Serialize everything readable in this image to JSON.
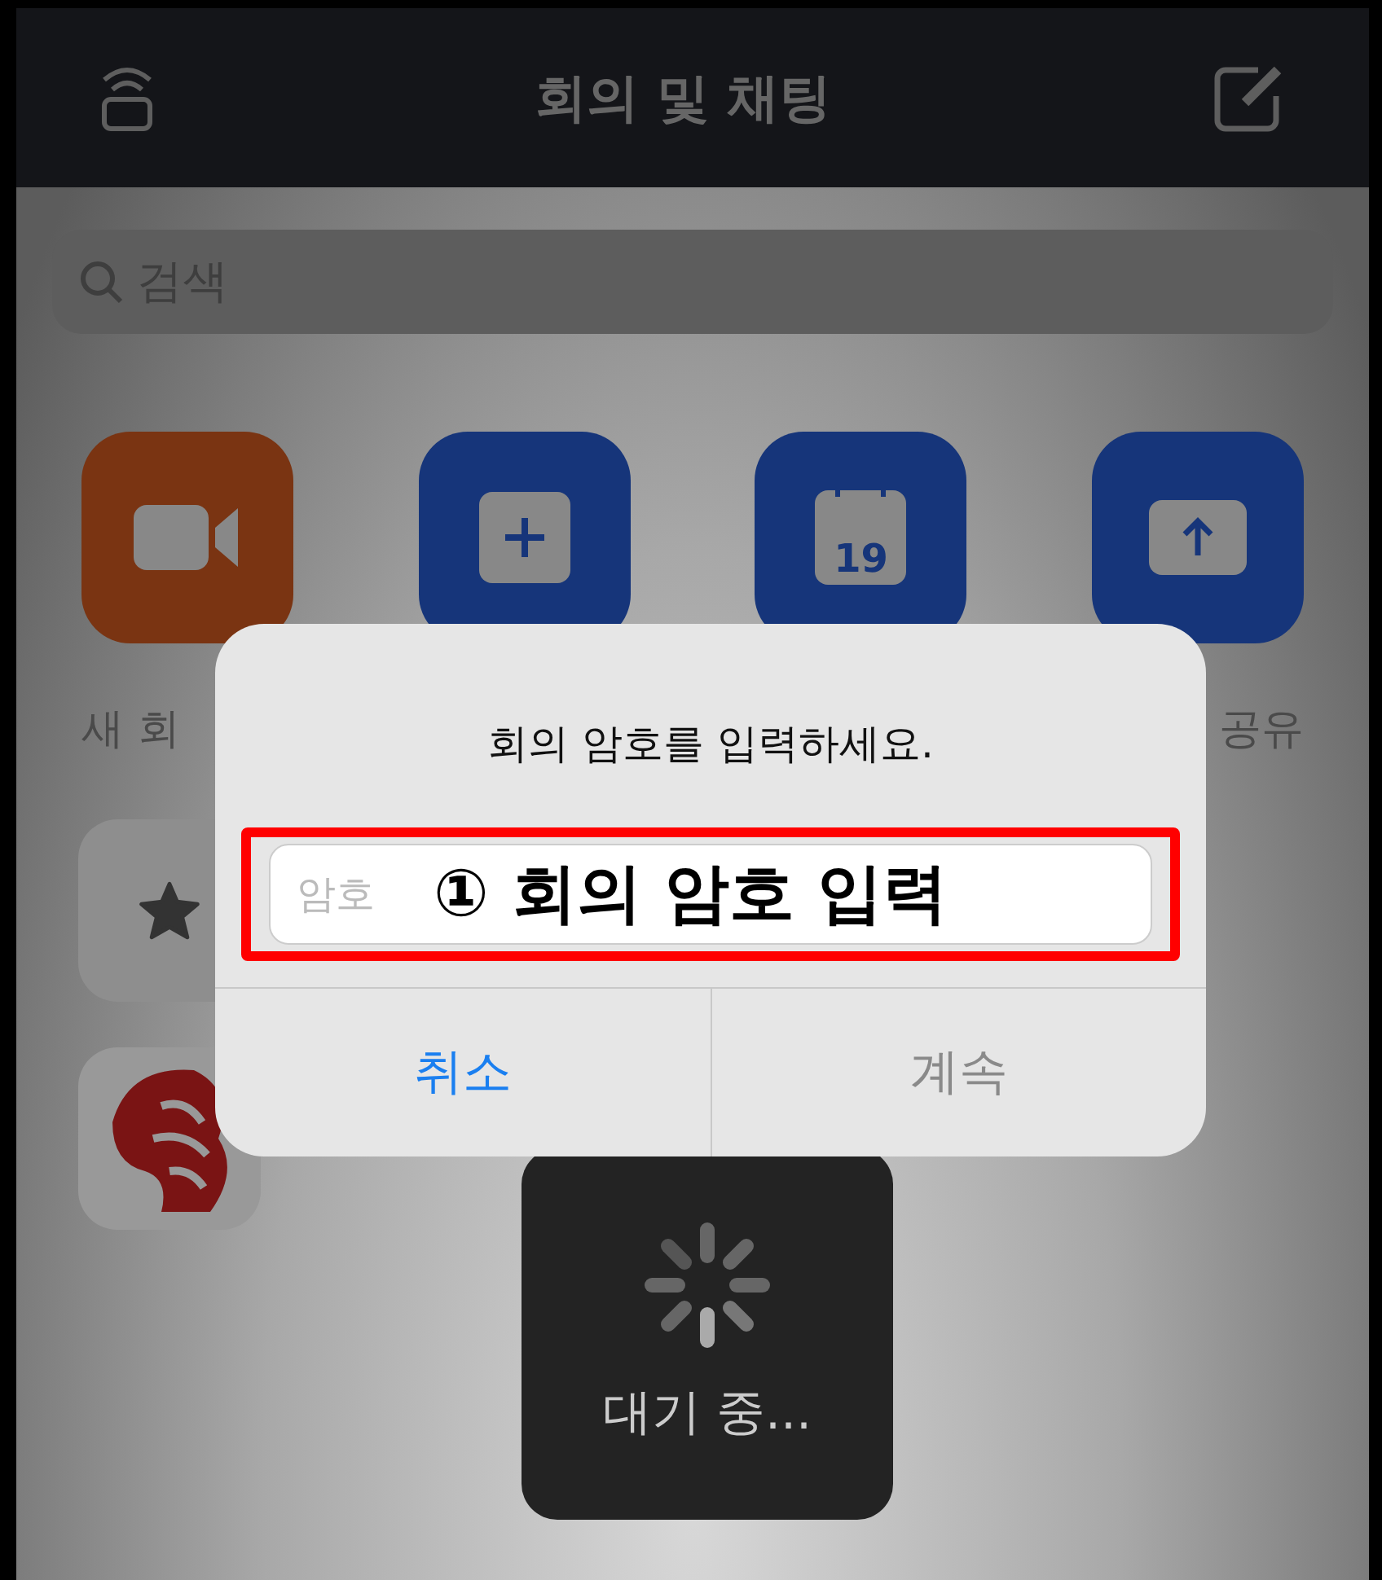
{
  "header": {
    "title": "회의 및 채팅"
  },
  "search": {
    "placeholder": "검색"
  },
  "tiles": [
    {
      "kind": "video",
      "color": "#7a3412",
      "label": "새 회"
    },
    {
      "kind": "plus",
      "color": "#16357a"
    },
    {
      "kind": "calendar",
      "color": "#16357a",
      "day": "19"
    },
    {
      "kind": "upload",
      "color": "#16357a",
      "label": "공유"
    }
  ],
  "dialog": {
    "message": "회의 암호를 입력하세요.",
    "field": {
      "placeholder": "암호"
    },
    "buttons": [
      {
        "label": "취소",
        "disabled": false
      },
      {
        "label": "계속",
        "disabled": true
      }
    ]
  },
  "annotation": {
    "label": "① 회의 암호 입력"
  },
  "loading": {
    "text": "대기 중..."
  }
}
